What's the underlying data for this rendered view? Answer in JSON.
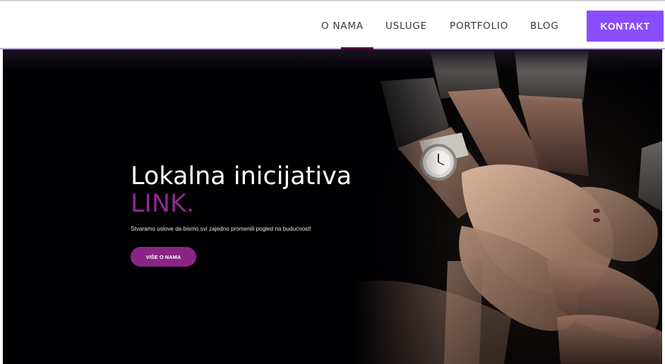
{
  "nav": {
    "items": [
      {
        "label": "O NAMA",
        "active": true
      },
      {
        "label": "USLUGE"
      },
      {
        "label": "PORTFOLIO"
      },
      {
        "label": "BLOG"
      }
    ],
    "cta_label": "KONTAKT"
  },
  "hero": {
    "title": "Lokalna inicijativa",
    "accent": "LINK.",
    "subtitle": "Stvaramo uslove da bismo svi zajedno promenili pogled na budućnost!",
    "button_label": "VIŠE O NAMA"
  },
  "colors": {
    "accent_purple": "#8a4cff",
    "brand_magenta": "#8d2a8e",
    "hero_background": "#010003"
  }
}
